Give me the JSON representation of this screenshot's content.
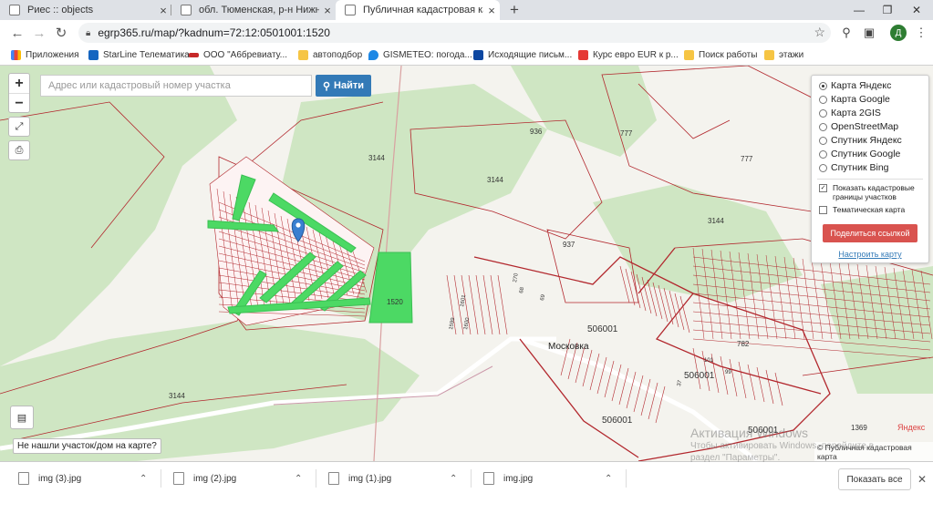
{
  "tabs": [
    {
      "title": "Риес :: objects",
      "active": false
    },
    {
      "title": "обл. Тюменская, р-н Нижнетав...",
      "active": false
    },
    {
      "title": "Публичная кадастровая карта -",
      "active": true
    }
  ],
  "toolbar": {
    "url": "egrp365.ru/map/?kadnum=72:12:0501001:1520",
    "avatar_letter": "Д"
  },
  "bookmarks": [
    {
      "label": "Приложения",
      "color": "#4285f4"
    },
    {
      "label": "StarLine Телематика",
      "color": "#1565c0"
    },
    {
      "label": "ООО \"А6бревиату...",
      "color": "#c62828"
    },
    {
      "label": "автоподбор",
      "color": "#f6c544"
    },
    {
      "label": "GISMETEO: погода...",
      "color": "#1e88e5"
    },
    {
      "label": "Исходящие письм...",
      "color": "#0d47a1"
    },
    {
      "label": "Курс евро EUR к р...",
      "color": "#e53935"
    },
    {
      "label": "Поиск работы",
      "color": "#f6c544"
    },
    {
      "label": "этажи",
      "color": "#f6c544"
    }
  ],
  "map": {
    "search_placeholder": "Адрес или кадастровый номер участка",
    "find_label": "Найти",
    "zoom_in": "+",
    "zoom_out": "−",
    "layers": [
      "Карта Яндекс",
      "Карта Google",
      "Карта 2GIS",
      "OpenStreetMap",
      "Спутник Яндекс",
      "Спутник Google",
      "Спутник Bing"
    ],
    "selected_layer": "Карта Яндекс",
    "show_cadastral": "Показать кадастровые границы участков",
    "show_cadastral_checked": true,
    "thematic": "Тематическая карта",
    "thematic_checked": false,
    "share_label": "Поделиться ссылкой",
    "config_label": "Настроить карту",
    "not_found": "Не нашли участок/дом на карте?",
    "attribution": "© Публичная кадастровая карта",
    "yandex_logo": "Яндекс",
    "labels": {
      "l936": "936",
      "l777a": "777",
      "l777b": "777",
      "l3144a": "3144",
      "l3144b": "3144",
      "l3144c": "3144",
      "l3144d": "3144",
      "l937": "937",
      "l1520": "1520",
      "l506001a": "506001",
      "l506001b": "506001",
      "l506001c": "506001",
      "l506001d": "506001",
      "l782": "782",
      "l1369": "1369",
      "moskovka": "Московка",
      "l1599": "1599",
      "l1600": "1600",
      "l1601": "1601",
      "l270": "270",
      "l69": "69",
      "l68": "68",
      "l37": "37",
      "l101": "101",
      "l99": "99"
    },
    "colors": {
      "highlight": "#4cd964",
      "boundary": "#b2272d"
    }
  },
  "downloads": {
    "files": [
      "img (3).jpg",
      "img (2).jpg",
      "img (1).jpg",
      "img.jpg"
    ],
    "show_all": "Показать все"
  },
  "watermark": {
    "line1": "Активация Windows",
    "line2": "Чтобы активировать Windows, перейдите в",
    "line3": "раздел \"Параметры\"."
  }
}
